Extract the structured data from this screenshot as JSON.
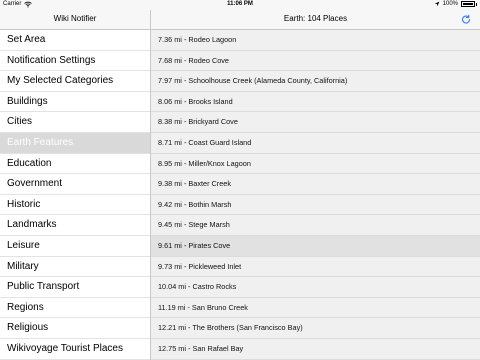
{
  "status": {
    "carrier": "Carrier",
    "time": "11:06 PM",
    "battery": "100%",
    "location_icon": "location-arrow-icon",
    "wifi_icon": "wifi-icon"
  },
  "sidebar": {
    "title": "Wiki Notifier",
    "items": [
      {
        "label": "Set Area"
      },
      {
        "label": "Notification Settings"
      },
      {
        "label": "My Selected Categories"
      },
      {
        "label": "Buildings"
      },
      {
        "label": "Cities"
      },
      {
        "label": "Earth Features"
      },
      {
        "label": "Education"
      },
      {
        "label": "Government"
      },
      {
        "label": "Historic"
      },
      {
        "label": "Landmarks"
      },
      {
        "label": "Leisure"
      },
      {
        "label": "Military"
      },
      {
        "label": "Public Transport"
      },
      {
        "label": "Regions"
      },
      {
        "label": "Religious"
      },
      {
        "label": "Wikivoyage Tourist Places"
      }
    ],
    "selected_index": 5
  },
  "main": {
    "title": "Earth: 104 Places",
    "refresh_icon": "refresh-icon",
    "accent_color": "#2f7df6",
    "places": [
      {
        "label": "7.36 mi - Rodeo Lagoon"
      },
      {
        "label": "7.68 mi - Rodeo Cove"
      },
      {
        "label": "7.97 mi - Schoolhouse Creek (Alameda County, California)"
      },
      {
        "label": "8.06 mi - Brooks Island"
      },
      {
        "label": "8.38 mi - Brickyard Cove"
      },
      {
        "label": "8.71 mi - Coast Guard Island"
      },
      {
        "label": "8.95 mi - Miller/Knox Lagoon"
      },
      {
        "label": "9.38 mi - Baxter Creek"
      },
      {
        "label": "9.42 mi - Bothin Marsh"
      },
      {
        "label": "9.45 mi - Stege Marsh"
      },
      {
        "label": "9.61 mi - Pirates Cove"
      },
      {
        "label": "9.73 mi - Pickleweed Inlet"
      },
      {
        "label": "10.04 mi - Castro Rocks"
      },
      {
        "label": "11.19 mi - San Bruno Creek"
      },
      {
        "label": "12.21 mi - The Brothers (San Francisco Bay)"
      },
      {
        "label": "12.75 mi - San Rafael Bay"
      }
    ],
    "highlighted_index": 10
  }
}
